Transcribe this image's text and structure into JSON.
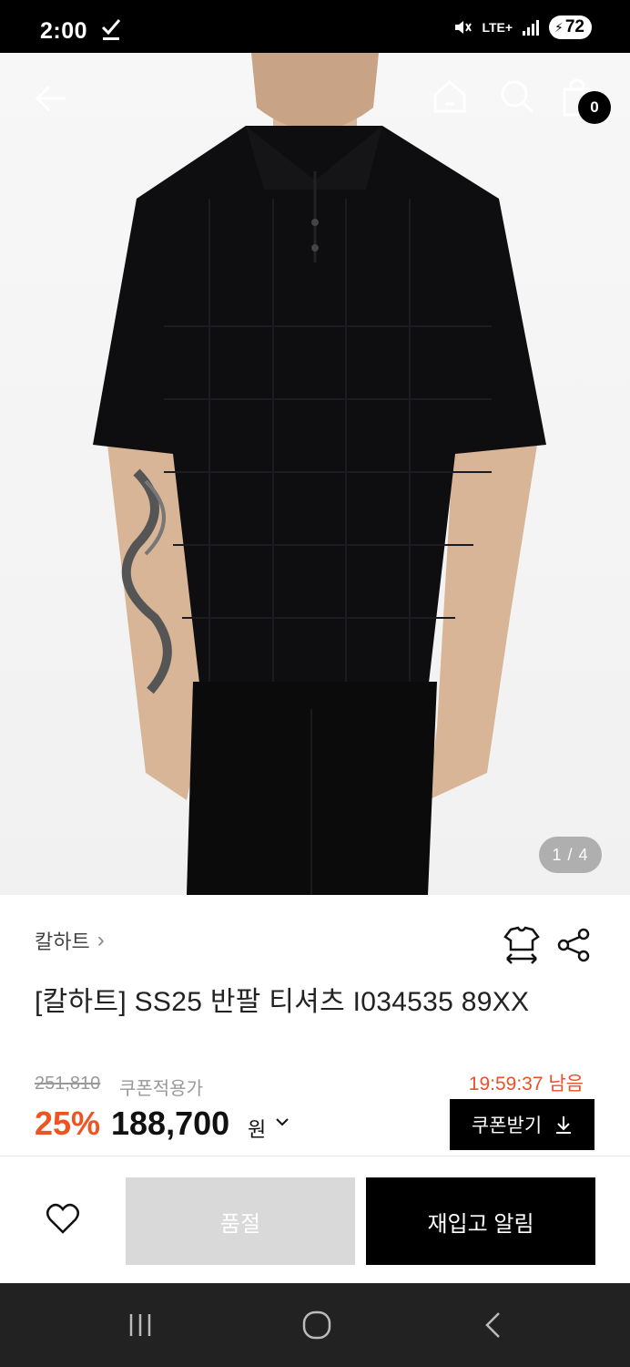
{
  "status_bar": {
    "time": "2:00",
    "network": "LTE+",
    "battery": "72"
  },
  "header": {
    "back_icon": "arrow-left-icon",
    "home_icon": "home-icon",
    "search_icon": "search-icon",
    "cart_icon": "shopping-bag-icon",
    "cart_count": "0"
  },
  "gallery": {
    "pager": "1 / 4"
  },
  "product": {
    "brand": "칼하트",
    "title": "[칼하트] SS25 반팔 티셔츠 I034535 89XX",
    "original_price": "251,810",
    "coupon_label": "쿠폰적용가",
    "timer": "19:59:37 남음",
    "discount": "25%",
    "price": "188,700",
    "currency": "원",
    "coupon_button": "쿠폰받기"
  },
  "actions": {
    "soldout_label": "품절",
    "restock_label": "재입고 알림"
  },
  "colors": {
    "accent": "#f0531f",
    "timer": "#e8512a",
    "black": "#000000",
    "soldout_bg": "#d9d9d9"
  }
}
